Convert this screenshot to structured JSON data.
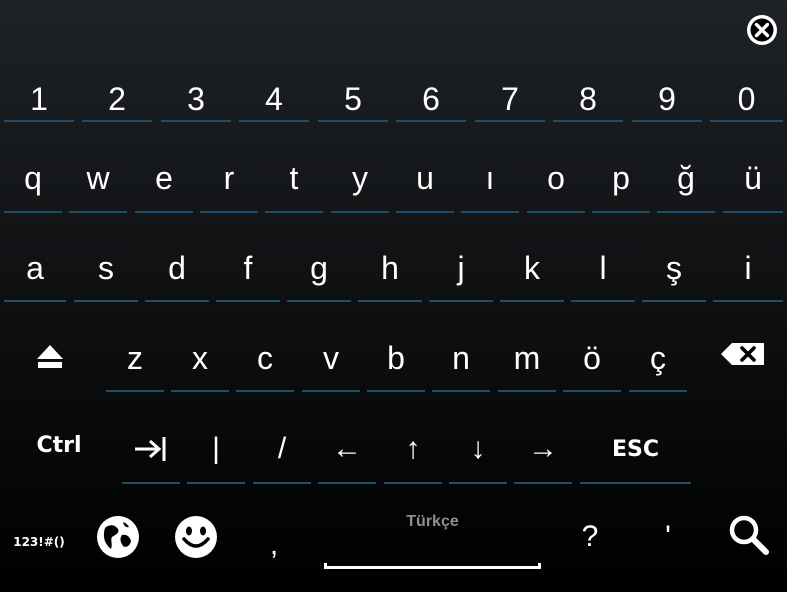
{
  "keyboard": {
    "language": "Türkçe",
    "numbers": [
      "1",
      "2",
      "3",
      "4",
      "5",
      "6",
      "7",
      "8",
      "9",
      "0"
    ],
    "row1": [
      "q",
      "w",
      "e",
      "r",
      "t",
      "y",
      "u",
      "ı",
      "o",
      "p",
      "ğ",
      "ü"
    ],
    "row2": [
      "a",
      "s",
      "d",
      "f",
      "g",
      "h",
      "j",
      "k",
      "l",
      "ş",
      "i"
    ],
    "row3": [
      "z",
      "x",
      "c",
      "v",
      "b",
      "n",
      "m",
      "ö",
      "ç"
    ],
    "row4": {
      "ctrl": "Ctrl",
      "pipe": "|",
      "slash": "/",
      "left": "←",
      "up": "↑",
      "down": "↓",
      "right": "→",
      "esc": "ESC"
    },
    "row5": {
      "symbols": "123!#()",
      "comma": ",",
      "question": "?",
      "apostrophe": "'"
    }
  },
  "icons": {
    "close": "close-circle-icon",
    "shift": "shift-icon",
    "backspace": "backspace-icon",
    "tab": "tab-icon",
    "globe": "globe-icon",
    "emoji": "emoji-icon",
    "search": "search-icon"
  },
  "colors": {
    "underline": "#1f4f68",
    "language_label": "#8c8f94"
  }
}
